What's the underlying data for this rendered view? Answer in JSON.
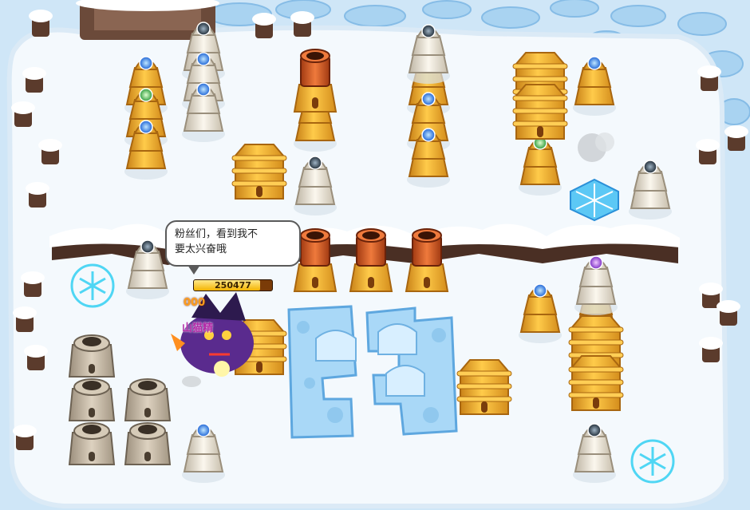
{
  "speech_bubble": {
    "text_line1": "粉丝们，看到我不",
    "text_line2": "要太兴奋哦"
  },
  "monster": {
    "hp_value": "250477",
    "hp_fraction": 0.85,
    "damage_text": "000",
    "name": "山猫精"
  },
  "colors": {
    "ice_bg": "#cfe6f7",
    "snow": "#f4f9fd",
    "wood": "#5b3b2c",
    "tower_gold": "#f3b23a",
    "tower_white": "#ede6d8",
    "ice_block": "#a9d8f7"
  },
  "gems": {
    "blue": "#2f7ce8",
    "purple": "#9a45d8",
    "green": "#39b54a",
    "dark": "#2c3b4a"
  }
}
